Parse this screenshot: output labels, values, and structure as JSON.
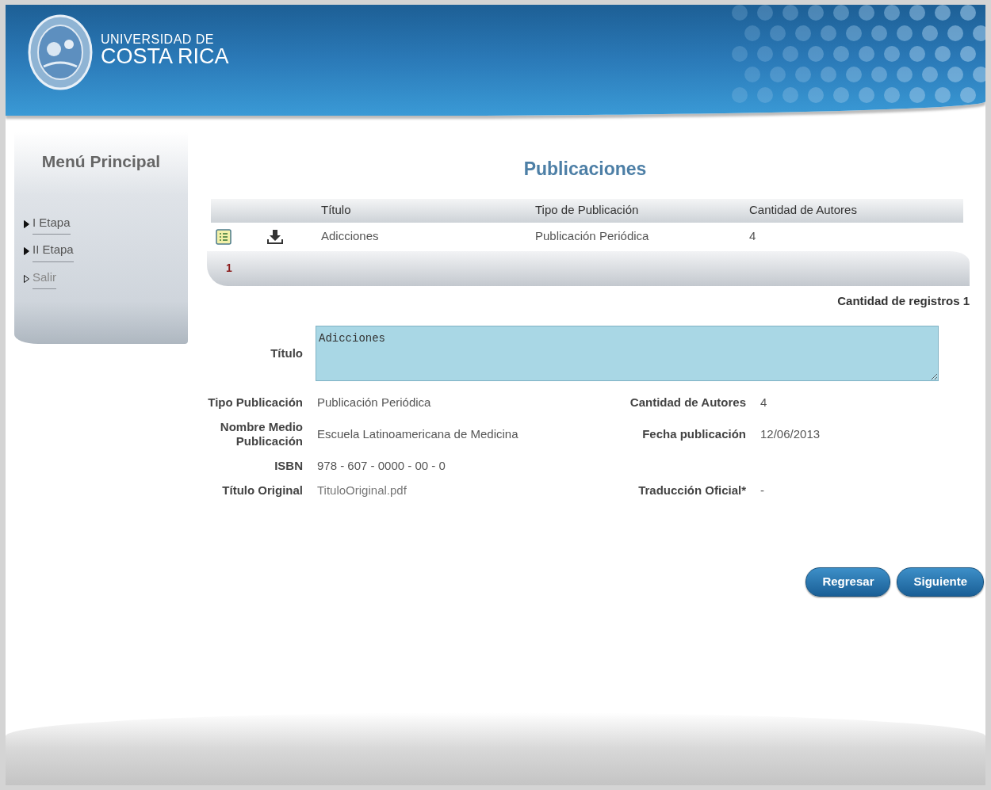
{
  "header": {
    "logo_line1": "UNIVERSIDAD DE",
    "logo_line2": "COSTA RICA"
  },
  "sidebar": {
    "title": "Menú Principal",
    "items": [
      {
        "label": "I Etapa",
        "kind": "filled"
      },
      {
        "label": "II Etapa",
        "kind": "filled"
      },
      {
        "label": "Salir",
        "kind": "outline"
      }
    ]
  },
  "page_title": "Publicaciones",
  "table": {
    "columns": [
      "Título",
      "Tipo de Publicación",
      "Cantidad de Autores"
    ],
    "rows": [
      {
        "cells": [
          "Adicciones",
          "Publicación Periódica",
          "4"
        ]
      }
    ]
  },
  "pagination": {
    "pages": [
      {
        "label": "1",
        "selected": true
      }
    ]
  },
  "record_count": "Cantidad de registros 1",
  "detail": {
    "title_label": "Título",
    "title_value": "Adicciones",
    "rows": [
      [
        {
          "label": "Tipo Publicación",
          "value": "Publicación Periódica",
          "kind": "text"
        },
        {
          "label": "Cantidad de Autores",
          "value": "4",
          "kind": "text"
        }
      ],
      [
        {
          "label": "Nombre Medio Publicación",
          "value": "Escuela Latinoamericana de Medicina",
          "kind": "text"
        },
        {
          "label": "Fecha publicación",
          "value": "12/06/2013",
          "kind": "text"
        }
      ],
      [
        {
          "label": "ISBN",
          "value": "978 - 607 - 0000 - 00 - 0",
          "kind": "text"
        }
      ],
      [
        {
          "label": "Título Original",
          "value": "TituloOriginal.pdf",
          "kind": "file"
        },
        {
          "label": "Traducción Oficial*",
          "value": "-",
          "kind": "text"
        }
      ]
    ]
  },
  "buttons": [
    "Regresar",
    "Siguiente"
  ]
}
